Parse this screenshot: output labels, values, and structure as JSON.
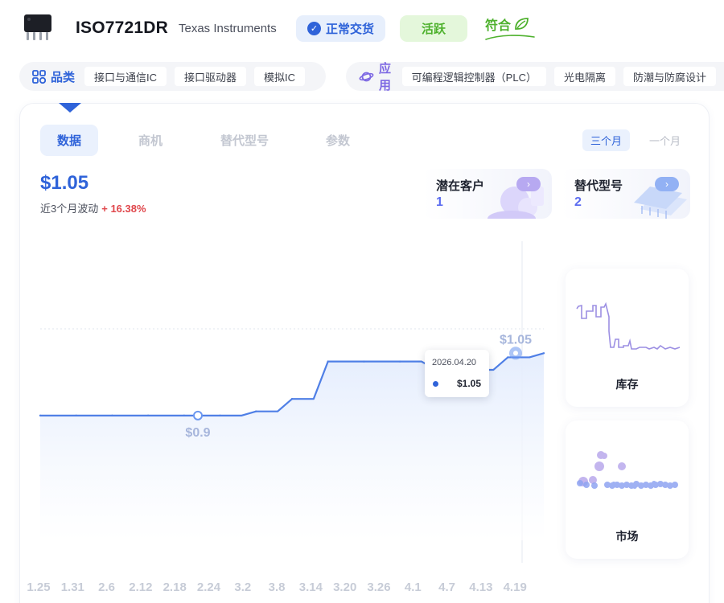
{
  "header": {
    "part_number": "ISO7721DR",
    "manufacturer": "Texas Instruments",
    "stock_badge": "正常交货",
    "status_badge": "活跃",
    "compliance_badge": "符合"
  },
  "categories": {
    "product_label": "品类",
    "product_tags": [
      "接口与通信IC",
      "接口驱动器",
      "模拟IC"
    ],
    "application_label": "应用",
    "application_tags": [
      "可编程逻辑控制器（PLC）",
      "光电隔离",
      "防潮与防腐设计"
    ]
  },
  "tabs": [
    "数据",
    "商机",
    "替代型号",
    "参数"
  ],
  "active_tab": 0,
  "ranges": [
    "三个月",
    "一个月"
  ],
  "active_range": 0,
  "price": {
    "current": "$1.05",
    "change_label": "近3个月波动",
    "change_value": "+ 16.38%"
  },
  "stats": [
    {
      "label": "潜在客户",
      "value": "1"
    },
    {
      "label": "替代型号",
      "value": "2"
    }
  ],
  "tooltip": {
    "date": "2026.04.20",
    "value": "$1.05"
  },
  "mini_cards": [
    "库存",
    "市场"
  ],
  "colors": {
    "primary": "#2f63d9",
    "accent_purple": "#7d68e3",
    "active_green": "#4eb12d",
    "negative_red": "#e0474c"
  },
  "chart_data": {
    "type": "line",
    "x": [
      "1.25",
      "1.31",
      "2.6",
      "2.12",
      "2.18",
      "2.24",
      "3.2",
      "3.8",
      "3.14",
      "3.20",
      "3.26",
      "4.1",
      "4.7",
      "4.13",
      "4.19"
    ],
    "series": [
      {
        "values": [
          0.9,
          0.9,
          0.9,
          0.9,
          0.9,
          0.9,
          0.91,
          0.94,
          1.03,
          1.03,
          1.03,
          1.01,
          1.01,
          1.04,
          1.05
        ]
      }
    ],
    "annotations": [
      {
        "x": "2.24",
        "value": 0.9,
        "label": "$0.9"
      },
      {
        "x": "4.19",
        "value": 1.05,
        "label": "$1.05"
      }
    ],
    "ylim": [
      0.6,
      1.3
    ],
    "grid": false,
    "legend": "none"
  }
}
